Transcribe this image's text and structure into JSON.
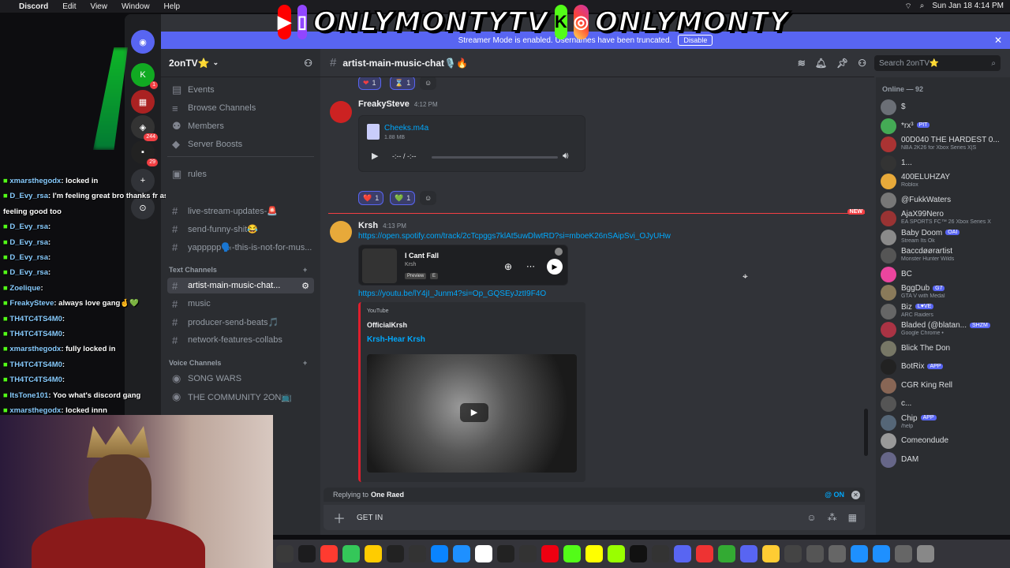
{
  "menubar": {
    "app": "Discord",
    "items": [
      "Edit",
      "View",
      "Window",
      "Help"
    ],
    "clock": "Sun Jan 18  4:14 PM"
  },
  "banner": {
    "handle1": "ONLYMONTYTV",
    "handle2": "ONLYMONTY"
  },
  "streamer_mode": {
    "text": "Streamer Mode is enabled. Usernames have been truncated.",
    "button": "Disable"
  },
  "server": {
    "name": "2onTV⭐"
  },
  "channels": {
    "top": [
      {
        "icon": "calendar-icon",
        "label": "Events"
      },
      {
        "icon": "browse-icon",
        "label": "Browse Channels"
      },
      {
        "icon": "members-icon",
        "label": "Members"
      },
      {
        "icon": "boost-icon",
        "label": "Server Boosts"
      }
    ],
    "list": [
      {
        "label": "rules"
      },
      {
        "label": "live-stream-updates-🚨"
      },
      {
        "label": "send-funny-shit😂"
      },
      {
        "label": "yappppp🗣️-this-is-not-for-mus..."
      }
    ],
    "text_category": "Text Channels",
    "text": [
      {
        "label": "artist-main-music-chat..."
      },
      {
        "label": "music"
      },
      {
        "label": "producer-send-beats🎵"
      },
      {
        "label": "network-features-collabs"
      }
    ],
    "voice_category": "Voice Channels",
    "voice": [
      {
        "label": "SONG WARS"
      },
      {
        "label": "THE COMMUNITY 2ON📺"
      }
    ]
  },
  "channel_header": {
    "name": "artist-main-music-chat🎙️🔥",
    "search_placeholder": "Search 2onTV⭐"
  },
  "messages": {
    "top_reactions": [
      "1",
      "1"
    ],
    "m1": {
      "author": "FreakySteve",
      "time": "4:12 PM",
      "file_name": "Cheeks.m4a",
      "file_size": "1.88 MB",
      "time_display": "-:-- / -:--",
      "reactions": [
        {
          "emoji": "❤️",
          "count": "1"
        },
        {
          "emoji": "💚",
          "count": "1"
        }
      ]
    },
    "new_label": "NEW",
    "m2": {
      "author": "Krsh",
      "time": "4:13 PM",
      "spotify_link": "https://open.spotify.com/track/2cTcpggs7klAt5uwDlwtRD?si=mboeK26nSAipSvi_OJyUHw",
      "spotify_title": "I Cant Fall",
      "spotify_artist": "Krsh",
      "spotify_preview": "Preview",
      "spotify_explicit": "E",
      "youtube_link": "https://youtu.be/lY4jI_Junm4?si=Op_GQSEyJztI9F4O",
      "yt_provider": "YouTube",
      "yt_channel": "OfficialKrsh",
      "yt_title": "Krsh-Hear Krsh"
    }
  },
  "composer": {
    "reply_prefix": "Replying to",
    "reply_to": "One Raed",
    "mention": "@ ON",
    "value": "GET IN"
  },
  "members": {
    "header": "Online — 92",
    "list": [
      {
        "name": "$",
        "status": "",
        "color": "#6b6f76"
      },
      {
        "name": "*rx³",
        "tag": "PIT",
        "status": "",
        "color": "#4a5"
      },
      {
        "name": "00D040 THE HARDEST 0...",
        "status": "NBA 2K26 for Xbox Series X|S",
        "color": "#a33"
      },
      {
        "name": "1...",
        "status": "",
        "color": "#333"
      },
      {
        "name": "400ELUHZAY",
        "status": "Roblox",
        "color": "#e7a93a"
      },
      {
        "name": "@FukkWaters",
        "status": "",
        "color": "#777"
      },
      {
        "name": "AjaX99Nero",
        "status": "EA SPORTS FC™ 26 Xbox Series X",
        "color": "#933"
      },
      {
        "name": "Baby Doom",
        "tag": "OAI",
        "status": "Stream Its Ok",
        "color": "#8a8a8a"
      },
      {
        "name": "Baccdøørartist",
        "status": "Monster Hunter Wilds",
        "color": "#555"
      },
      {
        "name": "BC",
        "status": "",
        "color": "#eb459e"
      },
      {
        "name": "BggDub",
        "tag": "G7",
        "status": "GTA V with Medal",
        "color": "#8a7a5a"
      },
      {
        "name": "Biz",
        "tag": "L♥VE",
        "status": "ARC Raiders",
        "color": "#666"
      },
      {
        "name": "Bladed (@blatan...",
        "tag": "SHZM",
        "status": "Google Chrome •",
        "color": "#a34"
      },
      {
        "name": "Blick The Don",
        "status": "",
        "color": "#776"
      },
      {
        "name": "BotRix",
        "tag": "APP",
        "status": "",
        "color": "#222"
      },
      {
        "name": "CGR King Rell",
        "status": "",
        "color": "#865"
      },
      {
        "name": "c...",
        "status": "",
        "color": "#555"
      },
      {
        "name": "Chip",
        "tag": "APP",
        "status": "/help",
        "color": "#567"
      },
      {
        "name": "Comeondude",
        "status": "",
        "color": "#999"
      },
      {
        "name": "DAM",
        "status": "",
        "color": "#668"
      }
    ]
  },
  "overlay_chat": [
    {
      "user": "xmarsthegodx",
      "msg": ": locked in"
    },
    {
      "user": "D_Evy_rsa",
      "msg": ": I'm feeling great bro thanks fr asking 🙏 hope u"
    },
    {
      "user": "",
      "msg": "feeling good too"
    },
    {
      "user": "D_Evy_rsa",
      "msg": ":"
    },
    {
      "user": "D_Evy_rsa",
      "msg": ":"
    },
    {
      "user": "D_Evy_rsa",
      "msg": ":"
    },
    {
      "user": "D_Evy_rsa",
      "msg": ":"
    },
    {
      "user": "Zoelique",
      "msg": ":"
    },
    {
      "user": "FreakySteve",
      "msg": ": always love gang🤞💚"
    },
    {
      "user": "TH4TC4TS4M0",
      "msg": ":"
    },
    {
      "user": "TH4TC4TS4M0",
      "msg": ":"
    },
    {
      "user": "xmarsthegodx",
      "msg": ": fully locked in"
    },
    {
      "user": "TH4TC4TS4M0",
      "msg": ":"
    },
    {
      "user": "TH4TC4TS4M0",
      "msg": ":"
    },
    {
      "user": "ItsTone101",
      "msg": ": Yoo what's discord gang"
    },
    {
      "user": "xmarsthegodx",
      "msg": ": locked innn"
    }
  ]
}
